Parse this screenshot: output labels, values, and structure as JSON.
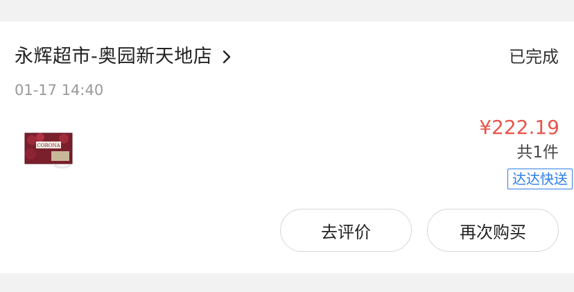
{
  "order": {
    "store_name": "永辉超市-奥园新天地店",
    "status": "已完成",
    "time": "01-17 14:40",
    "product_thumb_text": "CORONA",
    "price": "¥222.19",
    "item_count": "共1件",
    "delivery_tag": "达达快送"
  },
  "actions": {
    "review_label": "去评价",
    "rebuy_label": "再次购买"
  },
  "colors": {
    "price": "#e9534b",
    "tag": "#2b7de9",
    "background": "#f2f2f2"
  }
}
